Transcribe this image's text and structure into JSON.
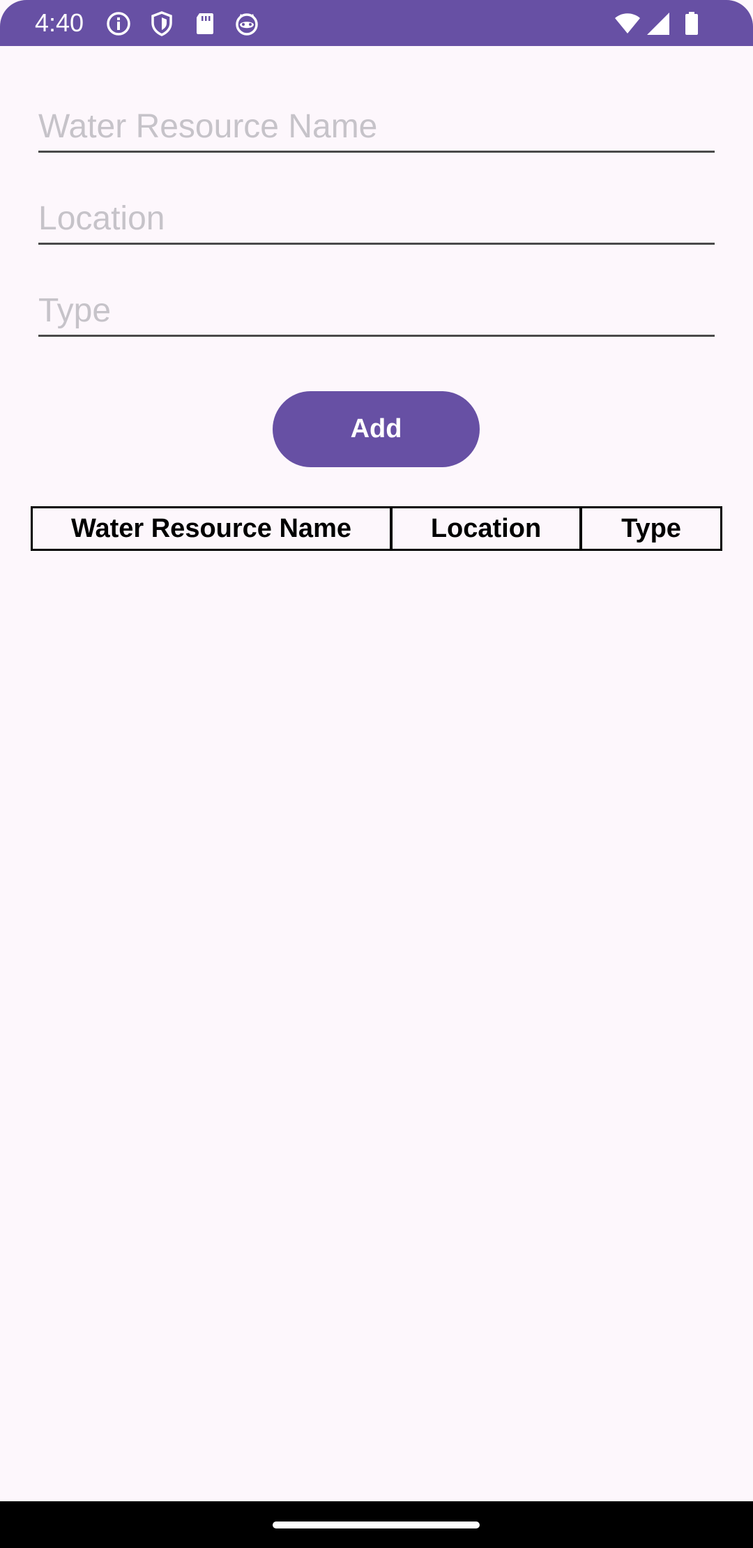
{
  "status_bar": {
    "time": "4:40",
    "icons": [
      "info-icon",
      "shield-icon",
      "sd-card-icon",
      "cat-face-icon",
      "wifi-icon",
      "signal-icon",
      "battery-icon"
    ],
    "background": "#6750a4"
  },
  "form": {
    "name_placeholder": "Water Resource Name",
    "name_value": "",
    "location_placeholder": "Location",
    "location_value": "",
    "type_placeholder": "Type",
    "type_value": ""
  },
  "add_button": {
    "label": "Add",
    "color": "#6750a4"
  },
  "table": {
    "headers": [
      "Water Resource Name",
      "Location",
      "Type"
    ],
    "rows": []
  },
  "colors": {
    "background": "#fdf7fc",
    "accent": "#6750a4",
    "placeholder": "#c6c3c9"
  }
}
